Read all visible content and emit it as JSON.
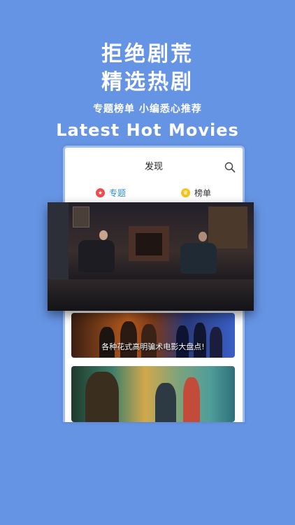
{
  "promo": {
    "headline1": "拒绝剧荒",
    "headline2": "精选热剧",
    "subheadline": "专题榜单 小编悉心推荐",
    "english": "Latest Hot Movies"
  },
  "app": {
    "title": "发现",
    "tabs": [
      {
        "label": "专题",
        "active": true
      },
      {
        "label": "榜单",
        "active": false
      }
    ],
    "cards": [
      {
        "caption": "各种花式高明骗术电影大盘点!"
      },
      {
        "caption": ""
      }
    ]
  },
  "colors": {
    "background": "#6694e4",
    "accent": "#2f8cf0",
    "tab_icon_1": "#f04a4a",
    "tab_icon_2": "#f7c21b"
  },
  "icons": {
    "search": "search-icon",
    "topic": "star-icon",
    "ranking": "trophy-icon"
  }
}
